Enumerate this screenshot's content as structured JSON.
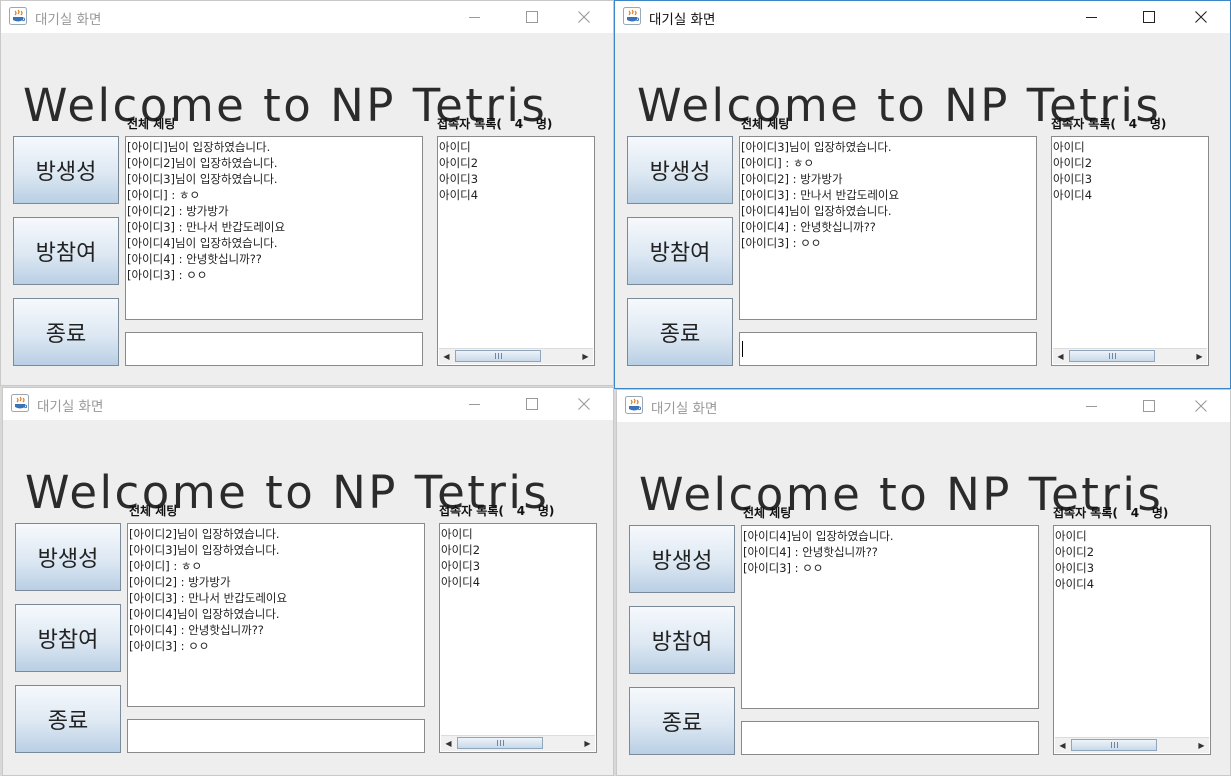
{
  "windows": [
    {
      "title": "대기실 화면",
      "welcome": "Welcome to NP Tetris",
      "buttons": {
        "create": "방생성",
        "join": "방참여",
        "exit": "종료"
      },
      "chat_label": "전체 체팅",
      "users_label_prefix": "접속자 목록(",
      "user_count": "4",
      "users_label_suffix": "명)",
      "chat_lines": [
        "[아이디]님이 입장하였습니다.",
        "[아이디2]님이 입장하였습니다.",
        "[아이디3]님이 입장하였습니다.",
        "[아이디] : ㅎㅇ",
        "[아이디2] : 방가방가",
        "[아이디3] : 만나서 반갑도레이요",
        "[아이디4]님이 입장하였습니다.",
        "[아이디4] : 안녕핫십니까??",
        "[아이디3] : ㅇㅇ"
      ],
      "users": [
        "아이디",
        "아이디2",
        "아이디3",
        "아이디4"
      ],
      "input_value": ""
    },
    {
      "title": "대기실 화면",
      "welcome": "Welcome to NP Tetris",
      "buttons": {
        "create": "방생성",
        "join": "방참여",
        "exit": "종료"
      },
      "chat_label": "전체 체팅",
      "users_label_prefix": "접속자 목록(",
      "user_count": "4",
      "users_label_suffix": "명)",
      "chat_lines": [
        "[아이디3]님이 입장하였습니다.",
        "[아이디] : ㅎㅇ",
        "[아이디2] : 방가방가",
        "[아이디3] : 만나서 반갑도레이요",
        "[아이디4]님이 입장하였습니다.",
        "[아이디4] : 안녕핫십니까??",
        "[아이디3] : ㅇㅇ"
      ],
      "users": [
        "아이디",
        "아이디2",
        "아이디3",
        "아이디4"
      ],
      "input_value": ""
    },
    {
      "title": "대기실 화면",
      "welcome": "Welcome to NP Tetris",
      "buttons": {
        "create": "방생성",
        "join": "방참여",
        "exit": "종료"
      },
      "chat_label": "전체 체팅",
      "users_label_prefix": "접속자 목록(",
      "user_count": "4",
      "users_label_suffix": "명)",
      "chat_lines": [
        "[아이디2]님이 입장하였습니다.",
        "[아이디3]님이 입장하였습니다.",
        "[아이디] : ㅎㅇ",
        "[아이디2] : 방가방가",
        "[아이디3] : 만나서 반갑도레이요",
        "[아이디4]님이 입장하였습니다.",
        "[아이디4] : 안녕핫십니까??",
        "[아이디3] : ㅇㅇ"
      ],
      "users": [
        "아이디",
        "아이디2",
        "아이디3",
        "아이디4"
      ],
      "input_value": ""
    },
    {
      "title": "대기실 화면",
      "welcome": "Welcome to NP Tetris",
      "buttons": {
        "create": "방생성",
        "join": "방참여",
        "exit": "종료"
      },
      "chat_label": "전체 체팅",
      "users_label_prefix": "접속자 목록(",
      "user_count": "4",
      "users_label_suffix": "명)",
      "chat_lines": [
        "[아이디4]님이 입장하였습니다.",
        "[아이디4] : 안녕핫십니까??",
        "[아이디3] : ㅇㅇ"
      ],
      "users": [
        "아이디",
        "아이디2",
        "아이디3",
        "아이디4"
      ],
      "input_value": ""
    }
  ]
}
